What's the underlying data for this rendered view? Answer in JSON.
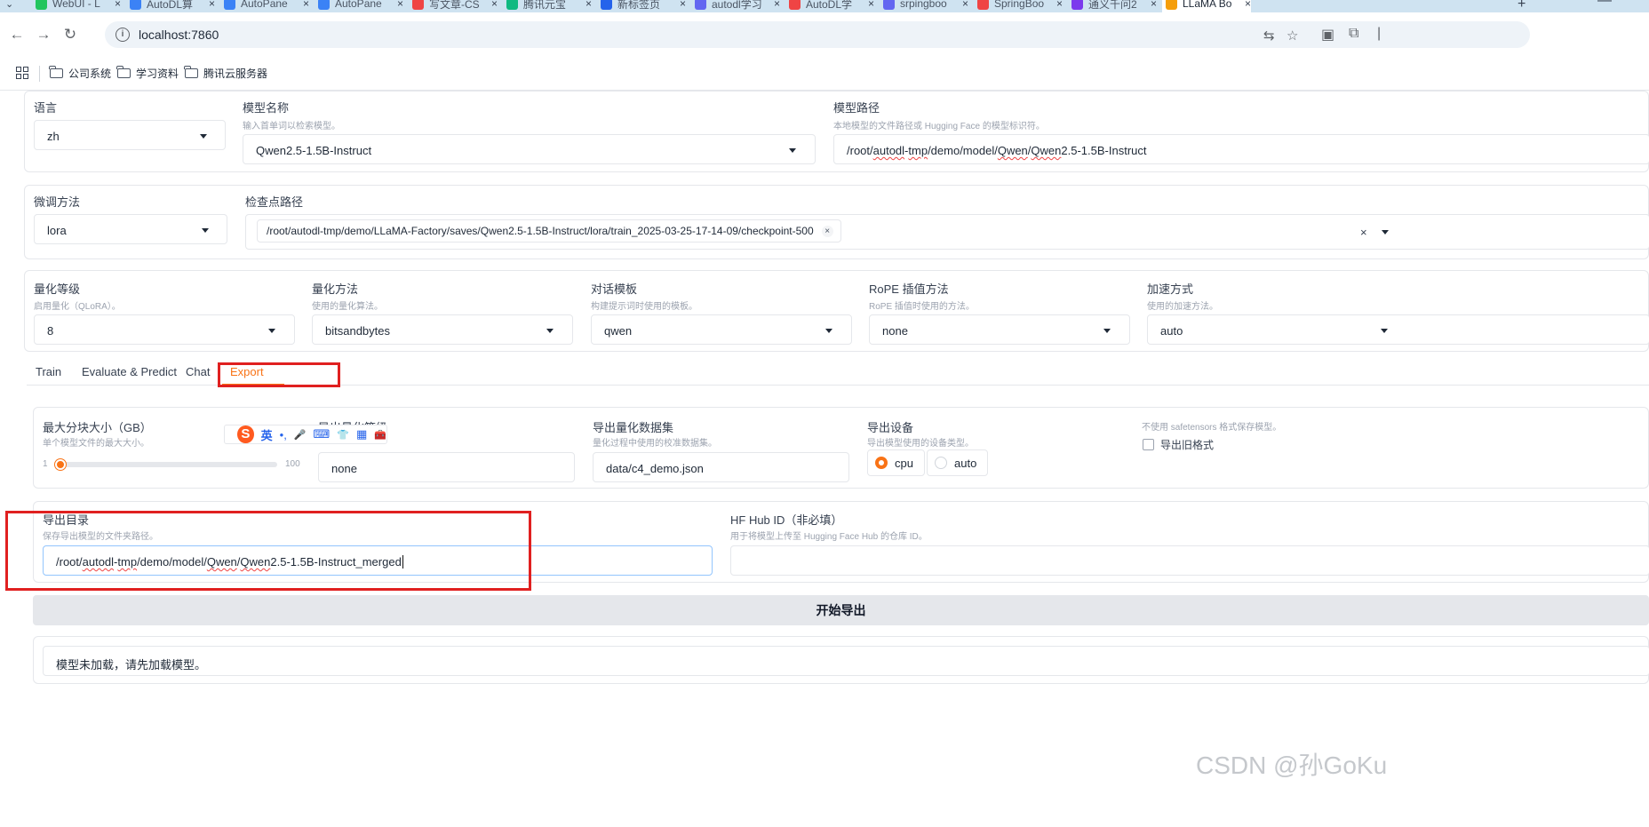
{
  "browser": {
    "tabs": [
      {
        "title": "WebUI - L",
        "color": "#22c55e"
      },
      {
        "title": "AutoDL算",
        "color": "#3b82f6"
      },
      {
        "title": "AutoPane",
        "color": "#3b82f6"
      },
      {
        "title": "AutoPane",
        "color": "#3b82f6"
      },
      {
        "title": "写文章-CS",
        "color": "#ef4444"
      },
      {
        "title": "腾讯元宝",
        "color": "#10b981"
      },
      {
        "title": "新标签页",
        "color": "#2563eb"
      },
      {
        "title": "autodl学习",
        "color": "#6366f1"
      },
      {
        "title": "AutoDL学",
        "color": "#ef4444"
      },
      {
        "title": "srpingboo",
        "color": "#6366f1"
      },
      {
        "title": "SpringBoo",
        "color": "#ef4444"
      },
      {
        "title": "通义千问2",
        "color": "#7c3aed"
      },
      {
        "title": "LLaMA Bo",
        "color": "#f59e0b"
      }
    ],
    "new_tab": "+",
    "url": "localhost:7860",
    "bookmarks": [
      "公司系统",
      "学习资料",
      "腾讯云服务器"
    ]
  },
  "top": {
    "language": {
      "label": "语言",
      "value": "zh"
    },
    "model_name": {
      "label": "模型名称",
      "hint": "输入首单词以检索模型。",
      "value": "Qwen2.5-1.5B-Instruct"
    },
    "model_path": {
      "label": "模型路径",
      "hint": "本地模型的文件路径或 Hugging Face 的模型标识符。",
      "value_parts": [
        "/root/",
        "autodl",
        "-",
        "tmp",
        "/demo/model/",
        "Qwen",
        "/",
        "Qwen",
        "2.5-1.5B-Instruct"
      ]
    }
  },
  "finetune": {
    "method": {
      "label": "微调方法",
      "value": "lora"
    },
    "checkpoint": {
      "label": "检查点路径",
      "value": "/root/autodl-tmp/demo/LLaMA-Factory/saves/Qwen2.5-1.5B-Instruct/lora/train_2025-03-25-17-14-09/checkpoint-500",
      "remove": "×",
      "clear": "×"
    }
  },
  "quant": {
    "level": {
      "label": "量化等级",
      "hint": "启用量化（QLoRA）。",
      "value": "8"
    },
    "method": {
      "label": "量化方法",
      "hint": "使用的量化算法。",
      "value": "bitsandbytes"
    },
    "template": {
      "label": "对话模板",
      "hint": "构建提示词时使用的模板。",
      "value": "qwen"
    },
    "rope": {
      "label": "RoPE 插值方法",
      "hint": "RoPE 插值时使用的方法。",
      "value": "none"
    },
    "accel": {
      "label": "加速方式",
      "hint": "使用的加速方法。",
      "value": "auto"
    }
  },
  "main_tabs": [
    "Train",
    "Evaluate & Predict",
    "Chat",
    "Export"
  ],
  "active_tab": "Export",
  "export": {
    "shard_size": {
      "label": "最大分块大小（GB）",
      "hint": "单个模型文件的最大大小。",
      "min": "1",
      "max": "100",
      "value": 1
    },
    "quant_bit": {
      "label": "导出量化等级",
      "value": "none"
    },
    "quant_dataset": {
      "label": "导出量化数据集",
      "hint": "量化过程中使用的校准数据集。",
      "value": "data/c4_demo.json"
    },
    "device": {
      "label": "导出设备",
      "hint": "导出模型使用的设备类型。",
      "options": [
        "cpu",
        "auto"
      ],
      "selected": "cpu"
    },
    "legacy": {
      "hint": "不使用 safetensors 格式保存模型。",
      "label": "导出旧格式",
      "checked": false
    },
    "dir": {
      "label": "导出目录",
      "hint": "保存导出模型的文件夹路径。",
      "value_parts": [
        "/root/",
        "autodl",
        "-",
        "tmp",
        "/demo/model/",
        "Qwen",
        "/",
        "Qwen",
        "2.5-1.5B-Instruct_merged"
      ]
    },
    "hub": {
      "label": "HF Hub ID（非必填）",
      "hint": "用于将模型上传至 Hugging Face Hub 的仓库 ID。",
      "value": ""
    },
    "start_button": "开始导出",
    "output": "模型未加载，请先加载模型。"
  },
  "ime": {
    "logo": "S",
    "mode": "英",
    "punct": "•,",
    "mic": "🎤",
    "kbd": "⌨",
    "shirt": "👕",
    "grid": "▦",
    "tools": "🧰"
  },
  "watermark": "CSDN @孙GoKu",
  "colors": {
    "accent": "#f97316",
    "highlight": "#e02020"
  }
}
